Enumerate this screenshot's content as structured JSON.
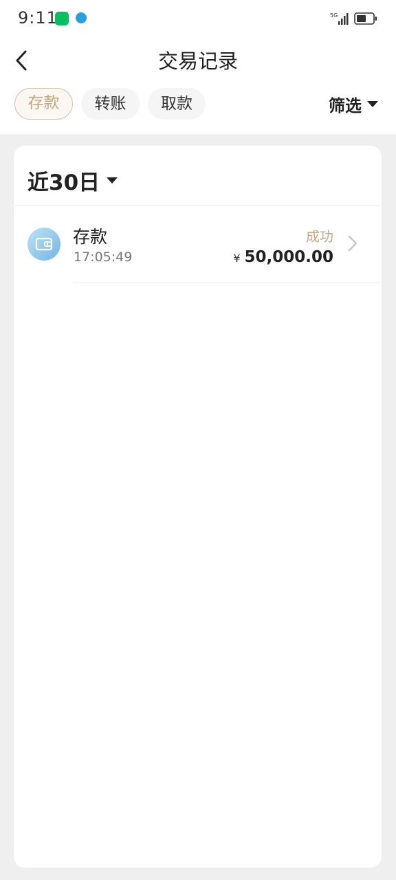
{
  "status_bar": {
    "time": "9:11",
    "icons": [
      "wechat-icon",
      "app-notification-icon",
      "signal-5g-icon",
      "battery-icon"
    ]
  },
  "header": {
    "title": "交易记录",
    "back_icon": "chevron-left-icon"
  },
  "tabs": [
    {
      "label": "存款",
      "active": true
    },
    {
      "label": "转账",
      "active": false
    },
    {
      "label": "取款",
      "active": false
    }
  ],
  "filter": {
    "label": "筛选",
    "icon": "caret-down-icon"
  },
  "period": {
    "label": "近30日",
    "icon": "caret-down-icon"
  },
  "transactions": [
    {
      "type": "存款",
      "time": "17:05:49",
      "status": "成功",
      "currency": "¥",
      "amount": "50,000.00",
      "icon": "wallet-icon"
    }
  ],
  "colors": {
    "accent": "#c9a87f",
    "background": "#efefef",
    "card": "#ffffff",
    "text_primary": "#222222"
  }
}
